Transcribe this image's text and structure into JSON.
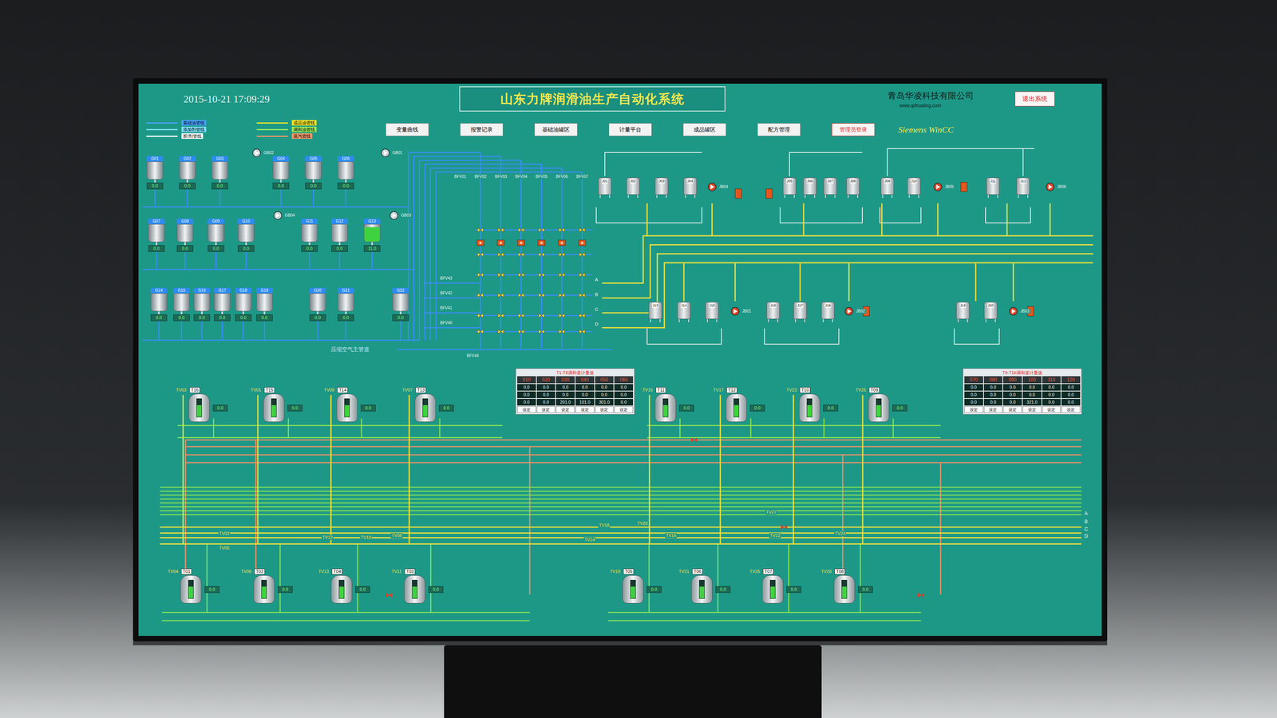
{
  "header": {
    "datetime": "2015-10-21  17:09:29",
    "title": "山东力牌润滑油生产自动化系统",
    "company": "青岛华凌科技有限公司",
    "url": "www.qdhualing.com",
    "brand": "Siemens WinCC",
    "exit_button": "退出系统"
  },
  "legend": [
    {
      "label": "基础油管线",
      "color": "#4aa3ff"
    },
    {
      "label": "添加剂管线",
      "color": "#7fe0ff"
    },
    {
      "label": "胶/剂管线",
      "color": "#ffffff"
    },
    {
      "label": "成品油管线",
      "color": "#f5e52a"
    },
    {
      "label": "调和油管线",
      "color": "#9ae85a"
    },
    {
      "label": "蒸汽管线",
      "color": "#f59a6a"
    }
  ],
  "nav": [
    {
      "label": "变量曲线",
      "kind": "button"
    },
    {
      "label": "报警记录",
      "kind": "button"
    },
    {
      "label": "基础油罐区",
      "kind": "button"
    },
    {
      "label": "计量平台",
      "kind": "button"
    },
    {
      "label": "成品罐区",
      "kind": "button"
    },
    {
      "label": "配方管理",
      "kind": "button"
    },
    {
      "label": "管理员登录",
      "kind": "login"
    }
  ],
  "storage_tanks": [
    {
      "label": "G01",
      "value": "0.0",
      "level": 0
    },
    {
      "label": "G02",
      "value": "0.0",
      "level": 0
    },
    {
      "label": "G03",
      "value": "0.0",
      "level": 0
    },
    {
      "label": "G04",
      "value": "0.0",
      "level": 0
    },
    {
      "label": "G05",
      "value": "0.0",
      "level": 0
    },
    {
      "label": "G06",
      "value": "0.0",
      "level": 0
    },
    {
      "label": "G07",
      "value": "0.0",
      "level": 0
    },
    {
      "label": "G08",
      "value": "0.0",
      "level": 0
    },
    {
      "label": "G09",
      "value": "0.0",
      "level": 0
    },
    {
      "label": "G10",
      "value": "0.0",
      "level": 0
    },
    {
      "label": "G11",
      "value": "0.0",
      "level": 0
    },
    {
      "label": "G12",
      "value": "0.0",
      "level": 0
    },
    {
      "label": "G13",
      "value": "11.0",
      "level": 0.85
    },
    {
      "label": "G14",
      "value": "0.0",
      "level": 0
    },
    {
      "label": "G15",
      "value": "0.0",
      "level": 0
    },
    {
      "label": "G16",
      "value": "0.0",
      "level": 0
    },
    {
      "label": "G17",
      "value": "0.0",
      "level": 0
    },
    {
      "label": "G18",
      "value": "0.0",
      "level": 0
    },
    {
      "label": "G19",
      "value": "0.0",
      "level": 0
    },
    {
      "label": "G20",
      "value": "0.0",
      "level": 0
    },
    {
      "label": "G21",
      "value": "0.0",
      "level": 0
    },
    {
      "label": "G22",
      "value": "0.0",
      "level": 0
    }
  ],
  "storage_pumps": [
    "GB02",
    "GB01",
    "GB04",
    "GB03"
  ],
  "manifold": {
    "valves_top": [
      "BFV01",
      "BFV02",
      "BFV03",
      "BFV04",
      "BFV05",
      "BFV06",
      "BFV07"
    ],
    "valves_left": [
      "BFV43",
      "BFV42",
      "BFV41",
      "BFV40"
    ],
    "valve_bottom": "BFV44",
    "air_main": "压缩空气主管道"
  },
  "grid_ends": [
    "A",
    "B",
    "C",
    "D"
  ],
  "mixers": [
    "J01",
    "J02",
    "J03",
    "J04",
    "J05",
    "J06",
    "J07",
    "J08",
    "J09",
    "J10",
    "J11",
    "J12",
    "J13",
    "J14",
    "J15",
    "J16",
    "J17",
    "J18",
    "J19",
    "J20"
  ],
  "mixer_pumps": [
    "JB04",
    "JB05",
    "JB06",
    "JB01",
    "JB02",
    "JB03"
  ],
  "reactors_top": [
    {
      "label": "T16",
      "valve": "TV03",
      "value": "0.0",
      "level": 0.65
    },
    {
      "label": "T15",
      "valve": "TV01",
      "value": "0.0",
      "level": 0.65
    },
    {
      "label": "T14",
      "valve": "TV09",
      "value": "0.0",
      "level": 0.65
    },
    {
      "label": "T13",
      "valve": "TV07",
      "value": "0.0",
      "level": 0.65
    },
    {
      "label": "T11",
      "valve": "TV15",
      "value": "0.0",
      "level": 0.65
    },
    {
      "label": "T12",
      "valve": "TV17",
      "value": "0.0",
      "level": 0.65
    },
    {
      "label": "T10",
      "valve": "TV23",
      "value": "0.0",
      "level": 0.65
    },
    {
      "label": "T09",
      "valve": "TV25",
      "value": "0.0",
      "level": 0.65
    }
  ],
  "reactors_bottom": [
    {
      "label": "T01",
      "valve": "TV04",
      "value": "0.0",
      "level": 0.65
    },
    {
      "label": "T02",
      "valve": "TV06",
      "value": "0.0",
      "level": 0.65
    },
    {
      "label": "T04",
      "valve": "TV13",
      "value": "0.0",
      "level": 0.65
    },
    {
      "label": "T03",
      "valve": "TV11",
      "value": "0.0",
      "level": 0.65
    },
    {
      "label": "T05",
      "valve": "TV19",
      "value": "0.0",
      "level": 0.65
    },
    {
      "label": "T06",
      "valve": "TV21",
      "value": "0.0",
      "level": 0.65
    },
    {
      "label": "T07",
      "valve": "TV26",
      "value": "0.0",
      "level": 0.65
    },
    {
      "label": "T08",
      "valve": "TV28",
      "value": "0.0",
      "level": 0.65
    }
  ],
  "line_valves": [
    "TV02",
    "TV05",
    "TV12",
    "TV10",
    "TV08",
    "TV14",
    "TV18",
    "TV20",
    "TV16",
    "TV22",
    "TV24",
    "TV27"
  ],
  "meters": [
    {
      "title": "T1-T8调和釜计量值",
      "columns": [
        {
          "code": "010",
          "values": [
            "0.0",
            "0.0",
            "0.0"
          ]
        },
        {
          "code": "020",
          "values": [
            "0.0",
            "0.0",
            "0.0"
          ]
        },
        {
          "code": "030",
          "values": [
            "0.0",
            "0.0",
            "201.0"
          ]
        },
        {
          "code": "040",
          "values": [
            "0.0",
            "0.0",
            "101.0"
          ]
        },
        {
          "code": "050",
          "values": [
            "0.0",
            "0.0",
            "301.0"
          ]
        },
        {
          "code": "060",
          "values": [
            "0.0",
            "0.0",
            "0.0"
          ]
        }
      ],
      "action": "设定"
    },
    {
      "title": "T9-T16调和釜计量值",
      "columns": [
        {
          "code": "070",
          "values": [
            "0.0",
            "0.0",
            "0.0"
          ]
        },
        {
          "code": "080",
          "values": [
            "0.0",
            "0.0",
            "0.0"
          ]
        },
        {
          "code": "090",
          "values": [
            "0.0",
            "0.0",
            "0.0"
          ]
        },
        {
          "code": "100",
          "values": [
            "0.0",
            "0.0",
            "321.0"
          ]
        },
        {
          "code": "110",
          "values": [
            "0.0",
            "0.0",
            "0.0"
          ]
        },
        {
          "code": "120",
          "values": [
            "0.0",
            "0.0",
            "0.0"
          ]
        }
      ],
      "action": "设定"
    }
  ],
  "bus_ends": [
    "A",
    "B",
    "C",
    "D"
  ]
}
